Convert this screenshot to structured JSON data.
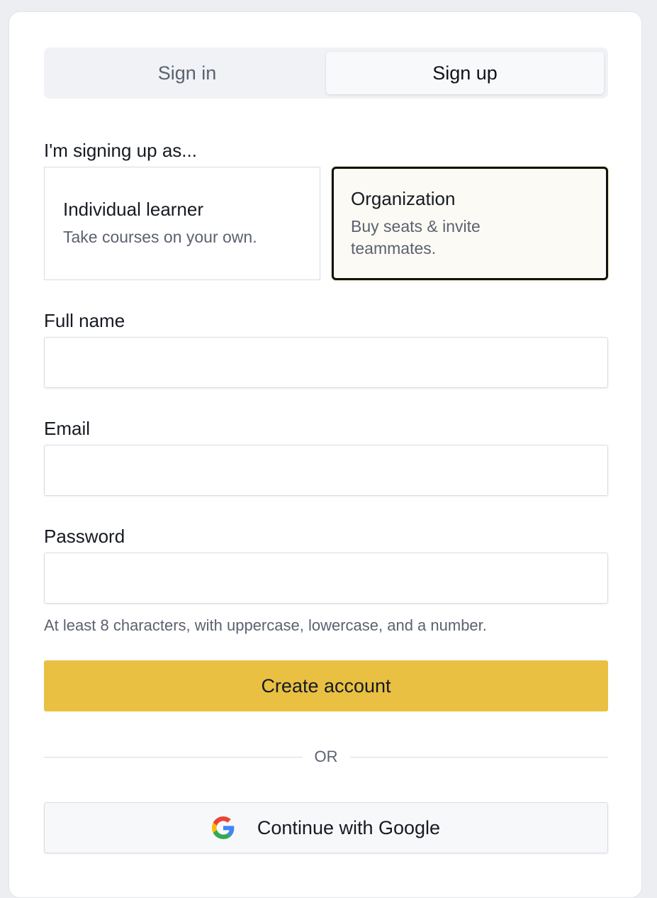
{
  "tabs": [
    {
      "label": "Sign in",
      "active": false
    },
    {
      "label": "Sign up",
      "active": true
    }
  ],
  "role_section": {
    "label": "I'm signing up as...",
    "options": [
      {
        "title": "Individual learner",
        "description": "Take courses on your own.",
        "selected": false
      },
      {
        "title": "Organization",
        "description": "Buy seats & invite teammates.",
        "selected": true
      }
    ]
  },
  "fields": {
    "full_name": {
      "label": "Full name",
      "value": "",
      "placeholder": ""
    },
    "email": {
      "label": "Email",
      "value": "",
      "placeholder": ""
    },
    "password": {
      "label": "Password",
      "value": "",
      "placeholder": "",
      "hint": "At least 8 characters, with uppercase, lowercase, and a number."
    }
  },
  "primary_button": {
    "label": "Create account"
  },
  "divider": {
    "label": "OR"
  },
  "google_button": {
    "label": "Continue with Google",
    "icon": "google-icon"
  },
  "colors": {
    "accent": "#e9c042",
    "selected_border": "#111111",
    "selected_bg": "#fcfaf4",
    "page_bg": "#eceef1"
  }
}
